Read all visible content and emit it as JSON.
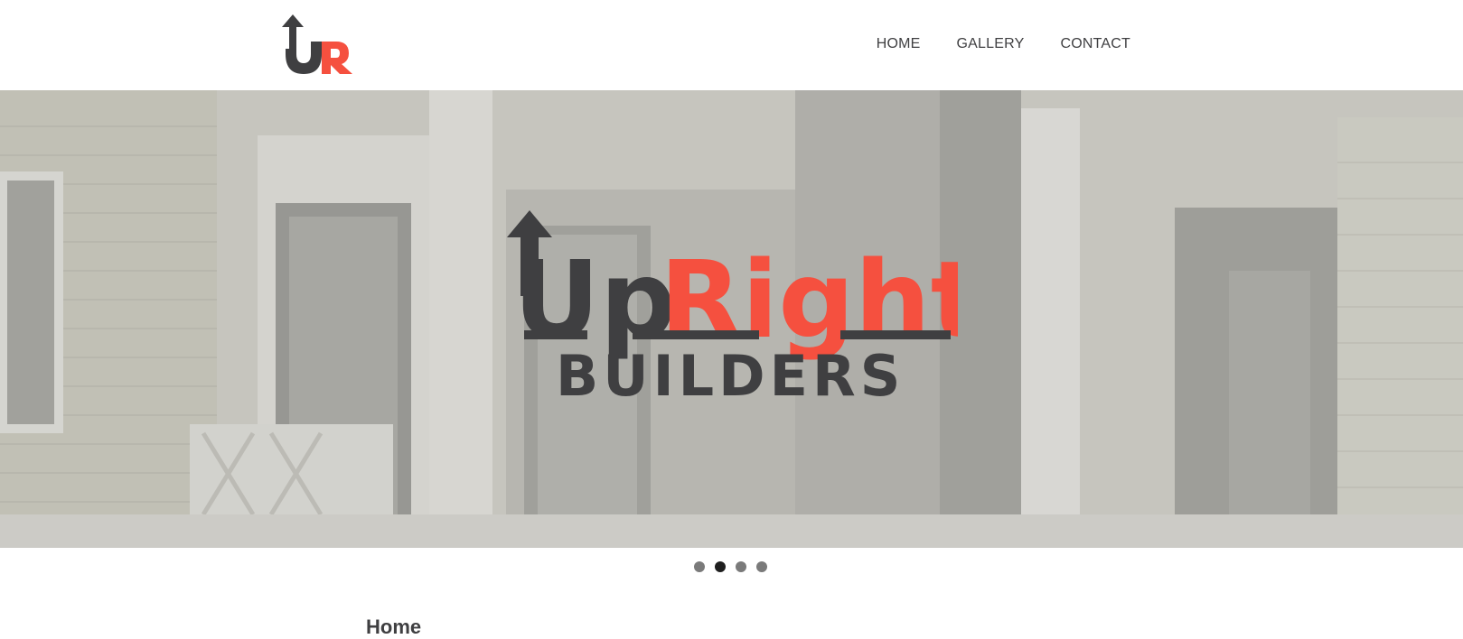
{
  "brand": {
    "name_up": "Up",
    "name_right": "Right",
    "tagline": "BUILDERS",
    "monogram_u": "U",
    "monogram_r": "R",
    "colors": {
      "dark": "#3f3f41",
      "accent": "#f5503f"
    }
  },
  "nav": {
    "items": [
      {
        "label": "HOME"
      },
      {
        "label": "GALLERY"
      },
      {
        "label": "CONTACT"
      }
    ]
  },
  "slider": {
    "slide_count": 4,
    "active_index": 1
  },
  "content": {
    "heading": "Home"
  }
}
